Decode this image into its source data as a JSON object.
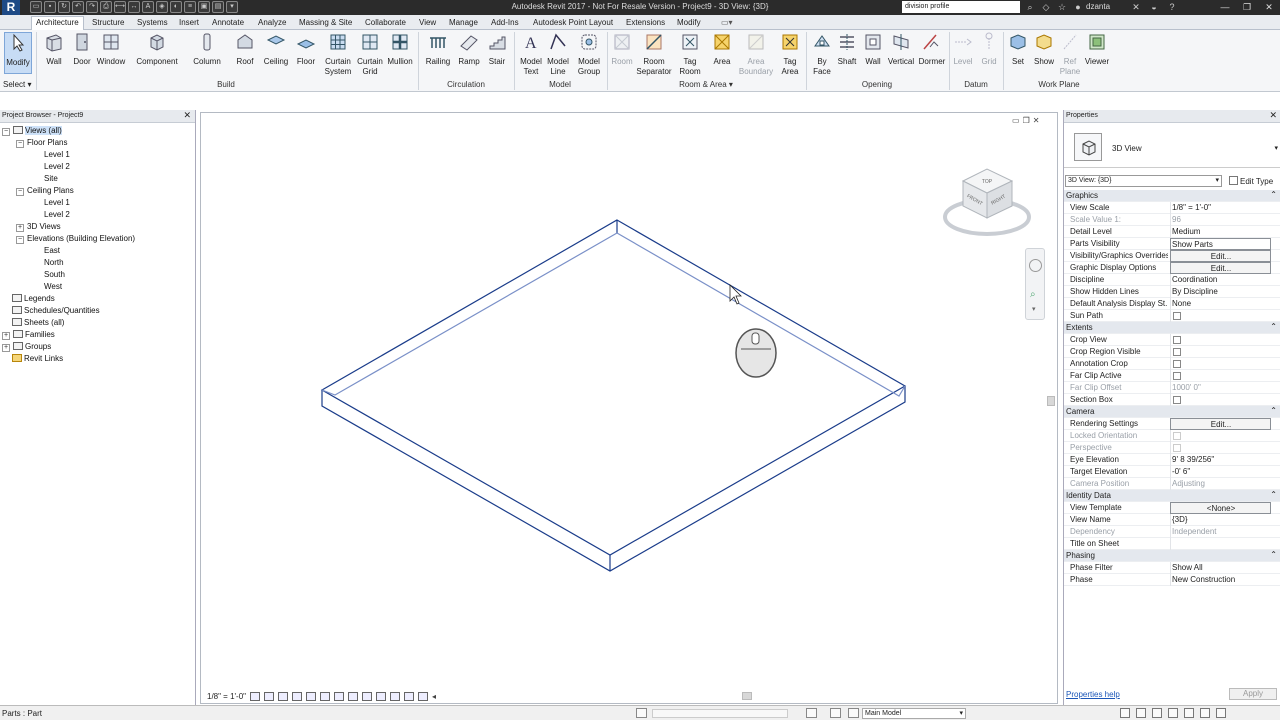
{
  "titlebar": {
    "title": "Autodesk Revit 2017 -  Not For Resale Version -   Project9 - 3D View: {3D}",
    "search_value": "division profile",
    "username": "dzanta"
  },
  "tabs": [
    "Architecture",
    "Structure",
    "Systems",
    "Insert",
    "Annotate",
    "Analyze",
    "Massing & Site",
    "Collaborate",
    "View",
    "Manage",
    "Add-Ins",
    "Autodesk Point Layout",
    "Extensions",
    "Modify"
  ],
  "ribbon": {
    "modify": "Modify",
    "select": "Select",
    "build": [
      "Wall",
      "Door",
      "Window",
      "Component",
      "Column",
      "Roof",
      "Ceiling",
      "Floor",
      "Curtain System",
      "Curtain Grid",
      "Mullion"
    ],
    "circulation": [
      "Railing",
      "Ramp",
      "Stair"
    ],
    "model": [
      "Model Text",
      "Model Line",
      "Model Group"
    ],
    "room_area": [
      "Room",
      "Room Separator",
      "Tag Room",
      "Area",
      "Area Boundary",
      "Tag Area"
    ],
    "opening": [
      "By Face",
      "Shaft",
      "Wall",
      "Vertical",
      "Dormer"
    ],
    "datum": [
      "Level",
      "Grid"
    ],
    "work_plane": [
      "Set",
      "Show",
      "Ref Plane",
      "Viewer"
    ],
    "panels": {
      "build": "Build",
      "circulation": "Circulation",
      "model": "Model",
      "room_area": "Room & Area",
      "opening": "Opening",
      "datum": "Datum",
      "work_plane": "Work Plane"
    }
  },
  "project_browser": {
    "title": "Project Browser - Project9",
    "views_all": "Views (all)",
    "floor_plans": "Floor Plans",
    "floor_levels": [
      "Level 1",
      "Level 2",
      "Site"
    ],
    "ceiling_plans": "Ceiling Plans",
    "ceiling_levels": [
      "Level 1",
      "Level 2"
    ],
    "views_3d": "3D Views",
    "elevations": "Elevations (Building Elevation)",
    "elevation_items": [
      "East",
      "North",
      "South",
      "West"
    ],
    "others": [
      "Legends",
      "Schedules/Quantities",
      "Sheets (all)",
      "Families",
      "Groups",
      "Revit Links"
    ]
  },
  "viewport": {
    "scale": "1/8\" = 1'-0\"",
    "viewcube_faces": [
      "TOP",
      "FRONT",
      "RIGHT"
    ]
  },
  "properties": {
    "title": "Properties",
    "type_name": "3D View",
    "instance": "3D View: {3D}",
    "edit_type": "Edit Type",
    "help": "Properties help",
    "apply": "Apply",
    "groups": {
      "graphics": "Graphics",
      "extents": "Extents",
      "camera": "Camera",
      "identity": "Identity Data",
      "phasing": "Phasing"
    },
    "graphics": [
      {
        "label": "View Scale",
        "value": "1/8\" = 1'-0\""
      },
      {
        "label": "Scale Value    1:",
        "value": "96"
      },
      {
        "label": "Detail Level",
        "value": "Medium"
      },
      {
        "label": "Parts Visibility",
        "value": "Show Parts"
      },
      {
        "label": "Visibility/Graphics Overrides",
        "value": "Edit..."
      },
      {
        "label": "Graphic Display Options",
        "value": "Edit..."
      },
      {
        "label": "Discipline",
        "value": "Coordination"
      },
      {
        "label": "Show Hidden Lines",
        "value": "By Discipline"
      },
      {
        "label": "Default Analysis Display St...",
        "value": "None"
      },
      {
        "label": "Sun Path",
        "value": ""
      }
    ],
    "extents": [
      {
        "label": "Crop View",
        "value": ""
      },
      {
        "label": "Crop Region Visible",
        "value": ""
      },
      {
        "label": "Annotation Crop",
        "value": ""
      },
      {
        "label": "Far Clip Active",
        "value": ""
      },
      {
        "label": "Far Clip Offset",
        "value": "1000'  0\""
      },
      {
        "label": "Section Box",
        "value": ""
      }
    ],
    "camera": [
      {
        "label": "Rendering Settings",
        "value": "Edit..."
      },
      {
        "label": "Locked Orientation",
        "value": ""
      },
      {
        "label": "Perspective",
        "value": ""
      },
      {
        "label": "Eye Elevation",
        "value": "9'  8 39/256\""
      },
      {
        "label": "Target Elevation",
        "value": "-0'  6\""
      },
      {
        "label": "Camera Position",
        "value": "Adjusting"
      }
    ],
    "identity": [
      {
        "label": "View Template",
        "value": "<None>"
      },
      {
        "label": "View Name",
        "value": "{3D}"
      },
      {
        "label": "Dependency",
        "value": "Independent"
      },
      {
        "label": "Title on Sheet",
        "value": ""
      }
    ],
    "phasing": [
      {
        "label": "Phase Filter",
        "value": "Show All"
      },
      {
        "label": "Phase",
        "value": "New Construction"
      }
    ]
  },
  "statusbar": {
    "text": "Parts : Part",
    "model": "Main Model"
  }
}
